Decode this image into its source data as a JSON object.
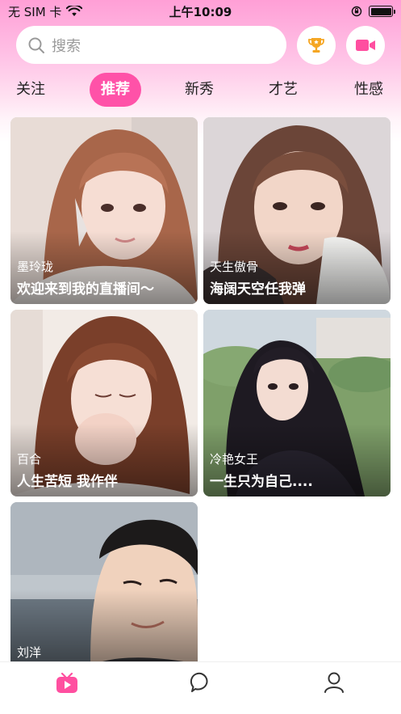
{
  "status_bar": {
    "carrier": "无 SIM 卡",
    "time": "上午10:09",
    "battery_level": 1.0
  },
  "header": {
    "search_placeholder": "搜索",
    "trophy_icon": "trophy-icon",
    "video_icon": "video-camera-icon",
    "accent_color": "#ff52a8"
  },
  "tabs": [
    {
      "label": "关注",
      "active": false
    },
    {
      "label": "推荐",
      "active": true
    },
    {
      "label": "新秀",
      "active": false
    },
    {
      "label": "才艺",
      "active": false
    },
    {
      "label": "性感",
      "active": false
    }
  ],
  "cards": [
    {
      "name": "墨玲珑",
      "caption": "欢迎来到我的直播间～"
    },
    {
      "name": "天生傲骨",
      "caption": "海阔天空任我弹"
    },
    {
      "name": "百合",
      "caption": "人生苦短 我作伴"
    },
    {
      "name": "冷艳女王",
      "caption": "一生只为自己...."
    },
    {
      "name": "刘洋",
      "caption": ""
    }
  ],
  "tab_bar": {
    "items": [
      {
        "icon": "live-tv-icon",
        "active": true
      },
      {
        "icon": "chat-bubble-icon",
        "active": false
      },
      {
        "icon": "profile-icon",
        "active": false
      }
    ]
  }
}
